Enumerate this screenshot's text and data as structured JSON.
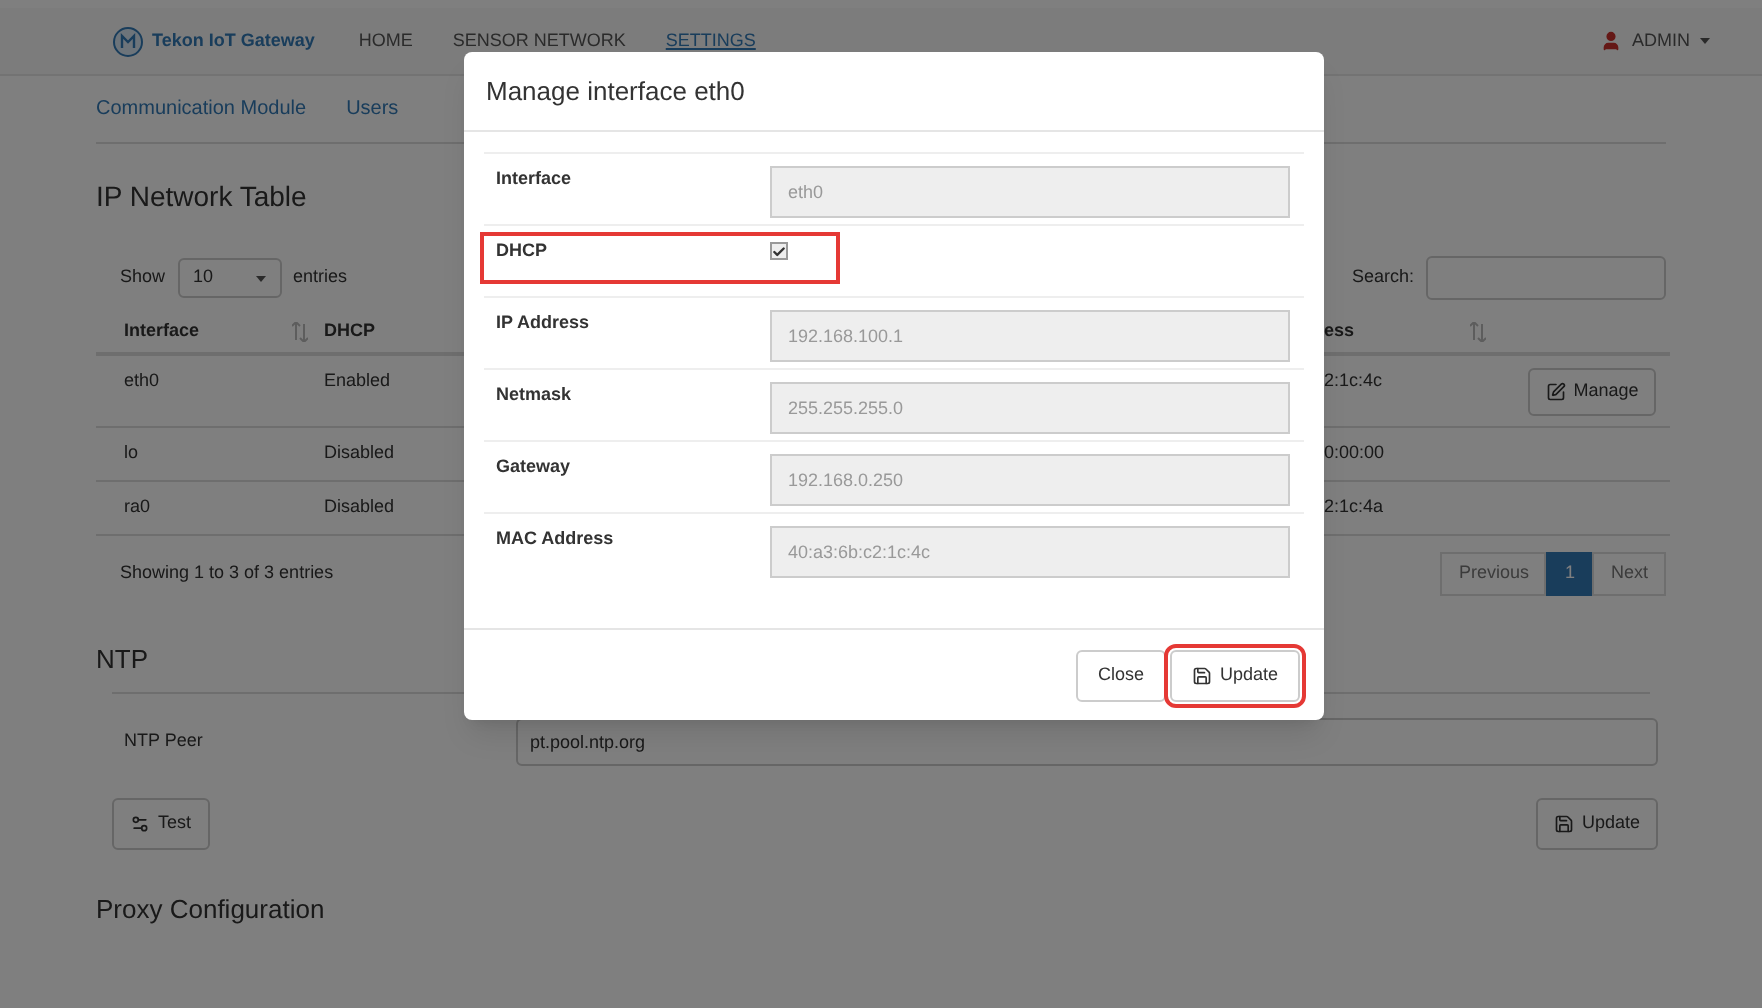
{
  "navbar": {
    "brand": "Tekon IoT Gateway",
    "links": [
      {
        "label": "HOME",
        "selected": false
      },
      {
        "label": "SENSOR NETWORK",
        "selected": false
      },
      {
        "label": "SETTINGS",
        "selected": true
      }
    ],
    "user": "ADMIN"
  },
  "subnav": [
    {
      "label": "Communication Module"
    },
    {
      "label": "Users"
    }
  ],
  "ip_table": {
    "title": "IP Network Table",
    "length_prefix": "Show",
    "length_value": "10",
    "length_suffix": "entries",
    "search_label": "Search:",
    "columns": [
      "Interface",
      "DHCP",
      "ess"
    ],
    "rows": [
      {
        "cells": [
          "eth0",
          "Enabled",
          "2:1c:4c"
        ],
        "action": "Manage"
      },
      {
        "cells": [
          "lo",
          "Disabled",
          "0:00:00"
        ]
      },
      {
        "cells": [
          "ra0",
          "Disabled",
          "2:1c:4a"
        ]
      }
    ],
    "info": "Showing 1 to 3 of 3 entries",
    "pagination": [
      {
        "label": "Previous",
        "selected": false
      },
      {
        "label": "1",
        "selected": true
      },
      {
        "label": "Next",
        "selected": false
      }
    ]
  },
  "ntp": {
    "title": "NTP",
    "peer_label": "NTP Peer",
    "peer_value": "pt.pool.ntp.org",
    "test_button": "Test",
    "update_button": "Update"
  },
  "proxy": {
    "title": "Proxy Configuration"
  },
  "modal": {
    "title": "Manage interface eth0",
    "fields": [
      {
        "kind": "text",
        "label": "Interface",
        "value": "eth0",
        "highlighted": false
      },
      {
        "kind": "checkbox",
        "label": "DHCP",
        "checked": true,
        "highlighted": true
      },
      {
        "kind": "text",
        "label": "IP Address",
        "value": "192.168.100.1",
        "highlighted": false
      },
      {
        "kind": "text",
        "label": "Netmask",
        "value": "255.255.255.0",
        "highlighted": false
      },
      {
        "kind": "text",
        "label": "Gateway",
        "value": "192.168.0.250",
        "highlighted": false
      },
      {
        "kind": "text",
        "label": "MAC Address",
        "value": "40:a3:6b:c2:1c:4c",
        "highlighted": false
      }
    ],
    "buttons": [
      {
        "kind": "close",
        "label": "Close",
        "highlighted": false
      },
      {
        "kind": "update",
        "label": "Update",
        "highlighted": true
      }
    ]
  }
}
